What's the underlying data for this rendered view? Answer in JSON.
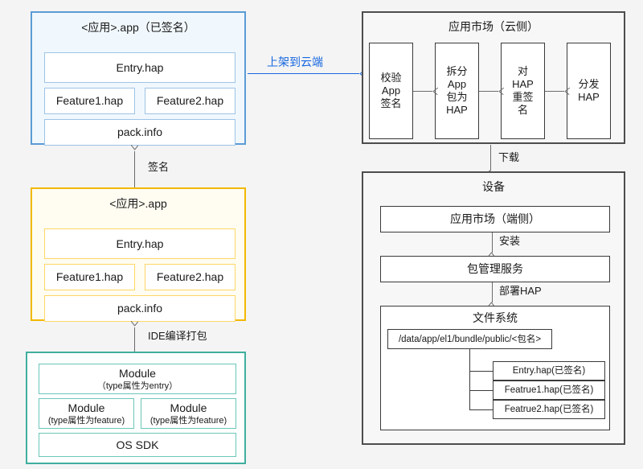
{
  "diagram": {
    "title": "HarmonyOS App packaging, distribution and installation flow",
    "colors": {
      "background": "#f4f4f4",
      "blue_border": "#5b9bd5",
      "blue_fill": "#f1f8fd",
      "yellow_border": "#f2b800",
      "yellow_fill": "#fffdf2",
      "teal_border": "#3fae9e",
      "grey_border": "#4d4d4d",
      "accent_blue": "#1767e0"
    }
  },
  "signed_app_package": {
    "title": "<应用>.app（已签名）",
    "items": [
      {
        "label": "Entry.hap"
      },
      {
        "label": "Feature1.hap"
      },
      {
        "label": "Feature2.hap"
      },
      {
        "label": "pack.info"
      }
    ]
  },
  "unsigned_app_package": {
    "title": "<应用>.app",
    "items": [
      {
        "label": "Entry.hap"
      },
      {
        "label": "Feature1.hap"
      },
      {
        "label": "Feature2.hap"
      },
      {
        "label": "pack.info"
      }
    ]
  },
  "project_package": {
    "modules": [
      {
        "label": "Module",
        "sub": "（type属性为entry）"
      },
      {
        "label": "Module",
        "sub": "(type属性为feature)"
      },
      {
        "label": "Module",
        "sub": "(type属性为feature)"
      }
    ],
    "sdk": {
      "label": "OS SDK"
    }
  },
  "app_market_cloud": {
    "title": "应用市场（云侧）",
    "steps": [
      {
        "label": "校验\nApp\n签名"
      },
      {
        "label": "拆分\nApp\n包为\nHAP"
      },
      {
        "label": "对\nHAP\n重签\n名"
      },
      {
        "label": "分发\nHAP"
      }
    ]
  },
  "device": {
    "title": "设备",
    "app_market_client": "应用市场（端侧）",
    "bundle_manager": "包管理服务",
    "file_system": {
      "title": "文件系统",
      "root_path": "/data/app/el1/bundle/public/<包名>",
      "files": [
        {
          "label": "Entry.hap(已签名)"
        },
        {
          "label": "Featrue1.hap(已签名)"
        },
        {
          "label": "Featrue2.hap(已签名)"
        }
      ]
    }
  },
  "connectors": {
    "upload_to_cloud": "上架到云端",
    "sign": "签名",
    "ide_build": "IDE编译打包",
    "download": "下载",
    "install": "安装",
    "deploy_hap": "部署HAP"
  }
}
